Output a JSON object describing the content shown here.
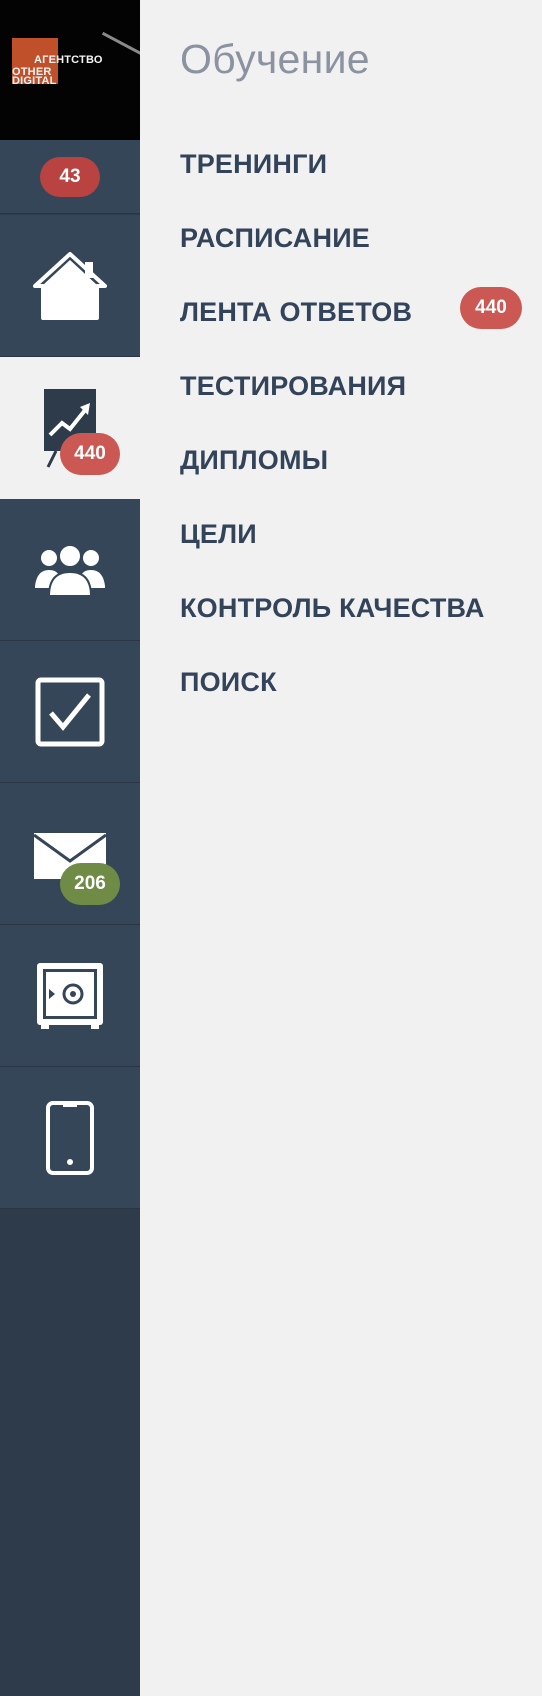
{
  "logo": {
    "line1": "АГЕНТСТВО",
    "line2": "OTHER",
    "line3": "DIGITAL"
  },
  "sidebar": {
    "top_counter": "43",
    "items": [
      {
        "icon": "home-icon",
        "badge": null
      },
      {
        "icon": "training-chart-icon",
        "badge": "440",
        "active": true
      },
      {
        "icon": "users-group-icon",
        "badge": null
      },
      {
        "icon": "checkbox-icon",
        "badge": null
      },
      {
        "icon": "mail-icon",
        "badge": "206"
      },
      {
        "icon": "safe-icon",
        "badge": null
      },
      {
        "icon": "mobile-phone-icon",
        "badge": null
      }
    ]
  },
  "panel": {
    "title": "Обучение",
    "menu": [
      {
        "label": "ТРЕНИНГИ"
      },
      {
        "label": "РАСПИСАНИЕ"
      },
      {
        "label": "ЛЕНТА ОТВЕТОВ",
        "badge": "440"
      },
      {
        "label": "ТЕСТИРОВАНИЯ"
      },
      {
        "label": "ДИПЛОМЫ"
      },
      {
        "label": "ЦЕЛИ"
      },
      {
        "label": "КОНТРОЛЬ КАЧЕСТВА"
      },
      {
        "label": "ПОИСК"
      }
    ]
  },
  "colors": {
    "sidebar_bg": "#364659",
    "sidebar_dark": "#2e3b4b",
    "panel_bg": "#f1f1f1",
    "menu_text": "#33445a",
    "title_text": "#8b93a1",
    "badge_red": "#cb5853",
    "badge_green": "#6f8b45"
  }
}
